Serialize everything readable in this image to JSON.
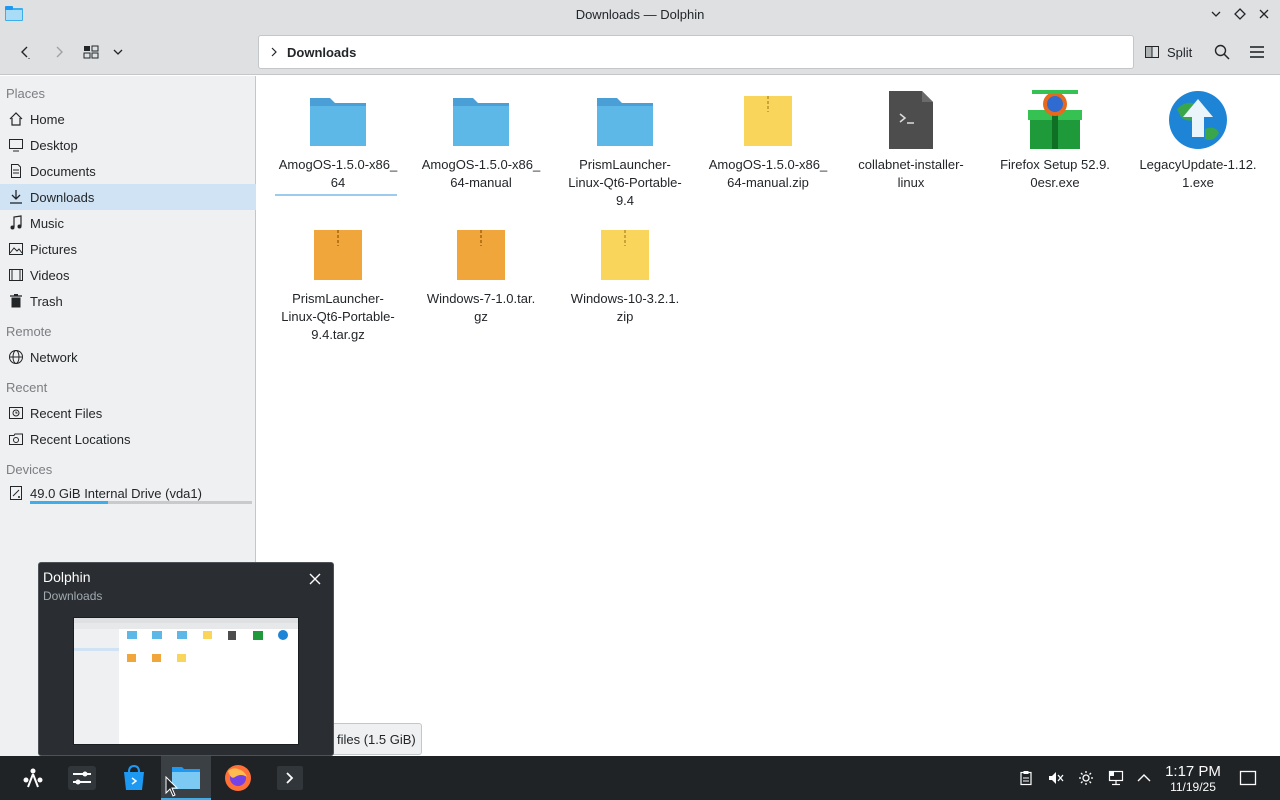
{
  "window": {
    "title": "Downloads — Dolphin"
  },
  "toolbar": {
    "breadcrumb": "Downloads",
    "split_label": "Split"
  },
  "sidebar": {
    "sections": {
      "places": "Places",
      "remote": "Remote",
      "recent": "Recent",
      "devices": "Devices"
    },
    "places": [
      {
        "label": "Home",
        "icon": "home-icon"
      },
      {
        "label": "Desktop",
        "icon": "desktop-icon"
      },
      {
        "label": "Documents",
        "icon": "documents-icon"
      },
      {
        "label": "Downloads",
        "icon": "downloads-icon",
        "active": true
      },
      {
        "label": "Music",
        "icon": "music-icon"
      },
      {
        "label": "Pictures",
        "icon": "pictures-icon"
      },
      {
        "label": "Videos",
        "icon": "videos-icon"
      },
      {
        "label": "Trash",
        "icon": "trash-icon"
      }
    ],
    "remote": [
      {
        "label": "Network",
        "icon": "network-icon"
      }
    ],
    "recent": [
      {
        "label": "Recent Files",
        "icon": "recent-files-icon"
      },
      {
        "label": "Recent Locations",
        "icon": "recent-locations-icon"
      }
    ],
    "devices": [
      {
        "label": "49.0 GiB Internal Drive (vda1)",
        "icon": "drive-icon",
        "usage_fraction": 0.35
      }
    ]
  },
  "files": [
    {
      "name": "AmogOS-1.5.0-x86_64",
      "line1": "AmogOS-1.5.0-x86_",
      "line2": "64",
      "line3": "",
      "type": "folder"
    },
    {
      "name": "AmogOS-1.5.0-x86_64-manual",
      "line1": "AmogOS-1.5.0-x86_",
      "line2": "64-manual",
      "line3": "",
      "type": "folder"
    },
    {
      "name": "PrismLauncher-Linux-Qt6-Portable-9.4",
      "line1": "PrismLauncher-",
      "line2": "Linux-Qt6-Portable-",
      "line3": "9.4",
      "type": "folder"
    },
    {
      "name": "AmogOS-1.5.0-x86_64-manual.zip",
      "line1": "AmogOS-1.5.0-x86_",
      "line2": "64-manual.zip",
      "line3": "",
      "type": "zip"
    },
    {
      "name": "collabnet-installer-linux",
      "line1": "collabnet-installer-",
      "line2": "linux",
      "line3": "",
      "type": "script"
    },
    {
      "name": "Firefox Setup 52.9.0esr.exe",
      "line1": "Firefox Setup 52.9.",
      "line2": "0esr.exe",
      "line3": "",
      "type": "exe-installer"
    },
    {
      "name": "LegacyUpdate-1.12.1.exe",
      "line1": "LegacyUpdate-1.12.",
      "line2": "1.exe",
      "line3": "",
      "type": "exe-update"
    },
    {
      "name": "PrismLauncher-Linux-Qt6-Portable-9.4.tar.gz",
      "line1": "PrismLauncher-",
      "line2": "Linux-Qt6-Portable-",
      "line3": "9.4.tar.gz",
      "type": "targz"
    },
    {
      "name": "Windows-7-1.0.tar.gz",
      "line1": "Windows-7-1.0.tar.",
      "line2": "gz",
      "line3": "",
      "type": "targz"
    },
    {
      "name": "Windows-10-3.2.1.zip",
      "line1": "Windows-10-3.2.1.",
      "line2": "zip",
      "line3": "",
      "type": "zip"
    }
  ],
  "status": {
    "text": "files (1.5 GiB)"
  },
  "preview": {
    "title": "Dolphin",
    "subtitle": "Downloads"
  },
  "taskbar": {
    "time": "1:17 PM",
    "date": "11/19/25"
  },
  "colors": {
    "accent": "#3daee9",
    "selection": "#cfe3f4",
    "folder": "#5db8e8",
    "zip": "#f9d55b",
    "targz": "#f0a63a"
  }
}
